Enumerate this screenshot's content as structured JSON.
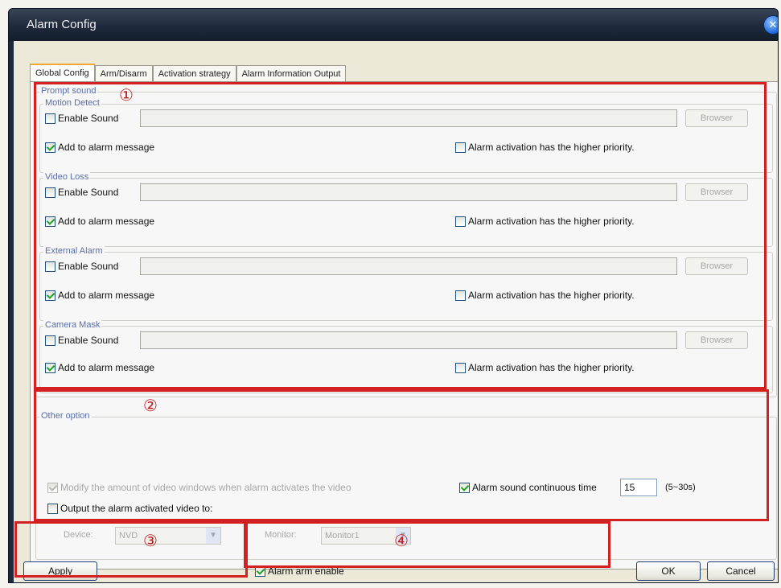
{
  "window": {
    "title": "Alarm Config",
    "close_icon": "close-icon"
  },
  "tabs": [
    "Global Config",
    "Arm/Disarm",
    "Activation strategy",
    "Alarm Information Output"
  ],
  "prompt_sound": {
    "legend": "Prompt sound",
    "groups": [
      {
        "legend": "Motion Detect",
        "enable_sound": "Enable Sound",
        "enable_checked": false,
        "browser": "Browser",
        "add_msg": "Add to alarm message",
        "add_checked": true,
        "priority": "Alarm activation has the higher priority.",
        "priority_checked": false
      },
      {
        "legend": "Video Loss",
        "enable_sound": "Enable Sound",
        "enable_checked": false,
        "browser": "Browser",
        "add_msg": "Add to alarm message",
        "add_checked": true,
        "priority": "Alarm activation has the higher priority.",
        "priority_checked": false
      },
      {
        "legend": "External Alarm",
        "enable_sound": "Enable Sound",
        "enable_checked": false,
        "browser": "Browser",
        "add_msg": "Add to alarm message",
        "add_checked": true,
        "priority": "Alarm activation has the higher priority.",
        "priority_checked": false
      },
      {
        "legend": "Camera Mask",
        "enable_sound": "Enable Sound",
        "enable_checked": false,
        "browser": "Browser",
        "add_msg": "Add to alarm message",
        "add_checked": true,
        "priority": "Alarm activation has the higher priority.",
        "priority_checked": false
      }
    ]
  },
  "other_option": {
    "legend": "Other option",
    "modify_windows": "Modify the amount of video windows when alarm activates the video",
    "modify_checked": true,
    "output_video": "Output the alarm activated video to:",
    "output_checked": false,
    "device_label": "Device:",
    "device_value": "NVD",
    "monitor_label": "Monitor:",
    "monitor_value": "Monitor1",
    "sound_time": "Alarm sound continuous time",
    "sound_time_checked": true,
    "sound_time_value": "15",
    "sound_time_range": "(5~30s)"
  },
  "footer": {
    "apply": "Apply",
    "alarm_arm_enable": "Alarm arm enable",
    "alarm_arm_checked": true,
    "ok": "OK",
    "cancel": "Cancel"
  },
  "annotations": [
    "①",
    "②",
    "③",
    "④"
  ],
  "colors": {
    "annotation_red": "#d42020",
    "legend_blue": "#5a6ea8",
    "title_bar": "#1e2a3b"
  }
}
